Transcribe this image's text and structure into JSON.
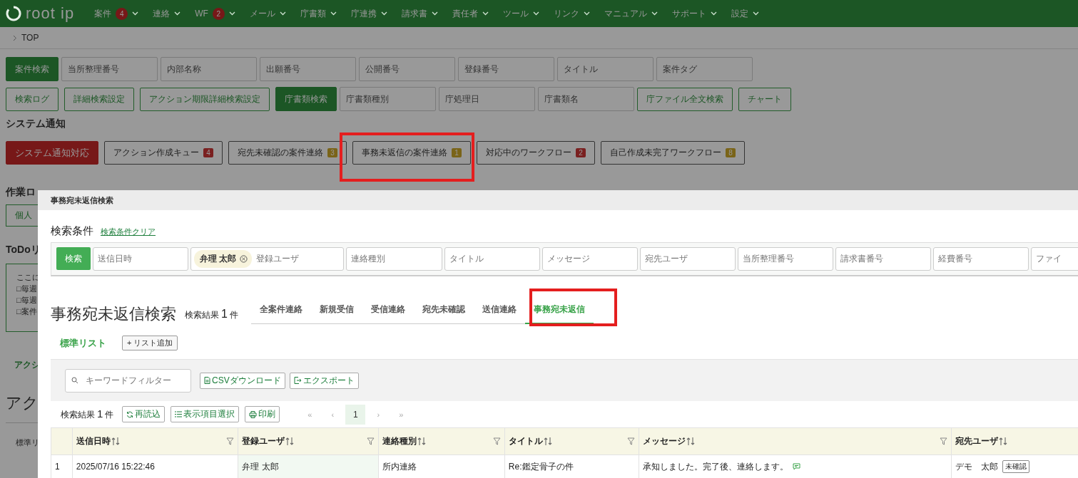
{
  "nav": {
    "logo": "root ip",
    "items": [
      {
        "label": "案件",
        "badge": "4"
      },
      {
        "label": "連絡"
      },
      {
        "label": "WF",
        "badge": "2"
      },
      {
        "label": "メール"
      },
      {
        "label": "庁書類"
      },
      {
        "label": "庁連携"
      },
      {
        "label": "請求書"
      },
      {
        "label": "責任者"
      },
      {
        "label": "ツール"
      },
      {
        "label": "リンク"
      },
      {
        "label": "マニュアル"
      },
      {
        "label": "サポート"
      },
      {
        "label": "設定"
      }
    ]
  },
  "breadcrumb": "TOP",
  "search_rows": [
    [
      {
        "kind": "primary",
        "label": "案件検索"
      },
      {
        "kind": "field",
        "placeholder": "当所整理番号"
      },
      {
        "kind": "field",
        "placeholder": "内部名称"
      },
      {
        "kind": "field",
        "placeholder": "出願番号"
      },
      {
        "kind": "field",
        "placeholder": "公開番号"
      },
      {
        "kind": "field",
        "placeholder": "登録番号"
      },
      {
        "kind": "field",
        "placeholder": "タイトル"
      },
      {
        "kind": "field",
        "placeholder": "案件タグ"
      }
    ],
    [
      {
        "kind": "outline",
        "label": "検索ログ"
      },
      {
        "kind": "outline",
        "label": "詳細検索設定"
      },
      {
        "kind": "outline",
        "label": "アクション期限詳細検索設定"
      },
      {
        "kind": "primary",
        "label": "庁書類検索"
      },
      {
        "kind": "field",
        "placeholder": "庁書類種別"
      },
      {
        "kind": "field",
        "placeholder": "庁処理日"
      },
      {
        "kind": "field",
        "placeholder": "庁書類名"
      },
      {
        "kind": "outline",
        "label": "庁ファイル全文検索"
      },
      {
        "kind": "outline",
        "label": "チャート"
      }
    ]
  ],
  "system_notice": {
    "heading": "システム通知",
    "buttons": [
      {
        "kind": "danger",
        "label": "システム通知対応"
      },
      {
        "kind": "plain",
        "label": "アクション作成キュー",
        "badge": "4",
        "color": "#7a2020"
      },
      {
        "kind": "plain",
        "label": "宛先未確認の案件連絡",
        "badge": "3",
        "color": "#7a6418"
      },
      {
        "kind": "plain",
        "label": "事務未返信の案件連絡",
        "badge": "1",
        "color": "#7a6418"
      },
      {
        "kind": "plain",
        "label": "対応中のワークフロー",
        "badge": "2",
        "color": "#7a2020"
      },
      {
        "kind": "plain",
        "label": "自己作成未完了ワークフロー",
        "badge": "8",
        "color": "#7a6418"
      }
    ]
  },
  "hidden_side": {
    "work_log_heading": "作業ロ",
    "work_log_button": "個人",
    "todo_heading": "ToDoリ",
    "todo_lines": [
      "ここに",
      "□毎週",
      "□毎週",
      "□案件"
    ],
    "action_link": "アクシ",
    "action_heading": "アク",
    "list_tab": "標準リ"
  },
  "dialog": {
    "title": "事務宛未返信検索",
    "conditions_label": "検索条件",
    "clear_link": "検索条件クリア",
    "search_button": "検索",
    "fields": [
      {
        "placeholder": "送信日時"
      },
      {
        "placeholder": "登録ユーザ",
        "chip": "弁理 太郎"
      },
      {
        "placeholder": "連絡種別"
      },
      {
        "placeholder": "タイトル"
      },
      {
        "placeholder": "メッセージ"
      },
      {
        "placeholder": "宛先ユーザ"
      },
      {
        "placeholder": "当所整理番号"
      },
      {
        "placeholder": "請求書番号"
      },
      {
        "placeholder": "経費番号"
      },
      {
        "placeholder": "ファイ"
      }
    ],
    "heading": "事務宛未返信検索",
    "result_label": "検索結果",
    "result_count": "1",
    "result_unit": "件",
    "tabs": [
      {
        "label": "全案件連絡",
        "selected": false
      },
      {
        "label": "新規受信",
        "selected": false
      },
      {
        "label": "受信連絡",
        "selected": false
      },
      {
        "label": "宛先未確認",
        "selected": false
      },
      {
        "label": "送信連絡",
        "selected": false
      },
      {
        "label": "事務宛未返信",
        "selected": true
      }
    ],
    "list_tab": "標準リスト",
    "add_list": "+ リスト追加",
    "keyword_placeholder": "キーワードフィルター",
    "csv_button": "CSVダウンロード",
    "export_button": "エクスポート",
    "toolbar": {
      "result_label": "検索結果",
      "result_count": "1",
      "result_unit": "件",
      "reload": "再読込",
      "columns": "表示項目選択",
      "print": "印刷"
    },
    "pager": {
      "first": "«",
      "prev": "‹",
      "pages": [
        {
          "label": "1",
          "selected": true
        }
      ],
      "next": "›",
      "last": "»"
    },
    "columns": [
      {
        "label": "送信日時"
      },
      {
        "label": "登録ユーザ",
        "highlighted": true
      },
      {
        "label": "連絡種別"
      },
      {
        "label": "タイトル"
      },
      {
        "label": "メッセージ"
      },
      {
        "label": "宛先ユーザ"
      }
    ],
    "rows": [
      {
        "number": "1",
        "cells": [
          {
            "text": "2025/07/16 15:22:46"
          },
          {
            "text": "弁理 太郎"
          },
          {
            "text": "所内連絡"
          },
          {
            "text": "Re:鑑定骨子の件"
          },
          {
            "text": "承知しました。完了後、連絡します。",
            "kind": "comment"
          },
          {
            "text": "デモ　太郎",
            "badge": "未確認"
          }
        ]
      }
    ]
  }
}
